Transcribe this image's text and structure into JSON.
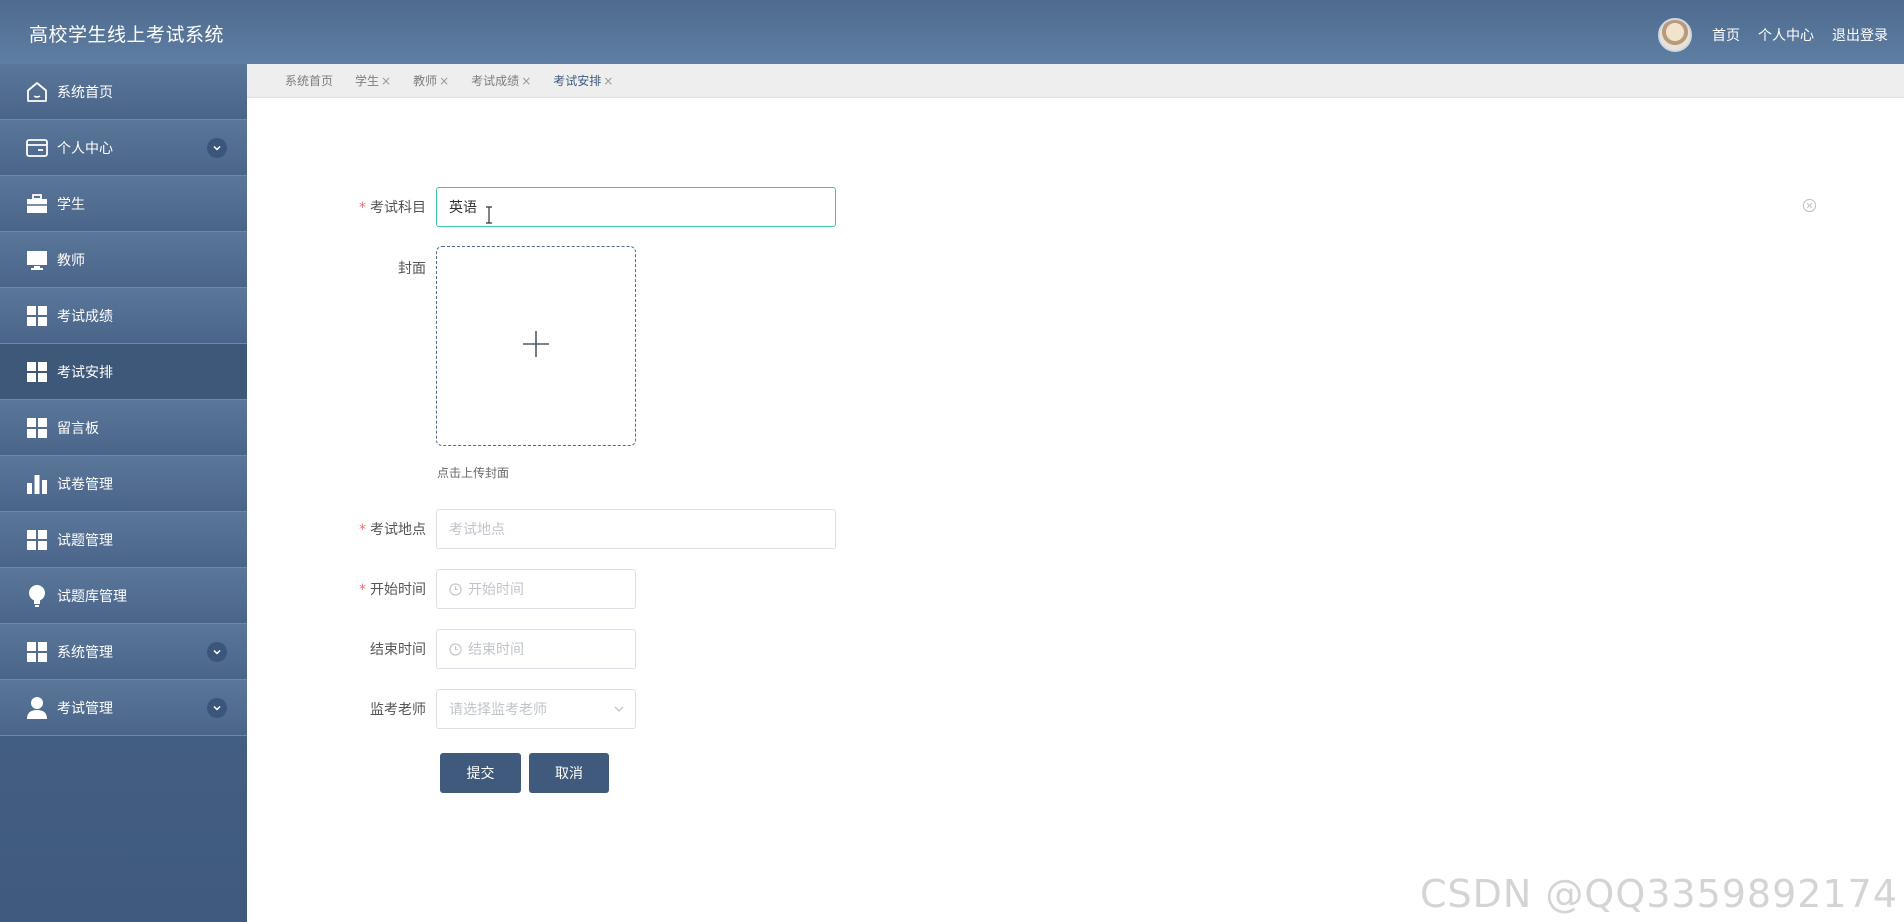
{
  "header": {
    "title": "高校学生线上考试系统",
    "links": [
      "首页",
      "个人中心",
      "退出登录"
    ]
  },
  "sidebar": {
    "items": [
      {
        "label": "系统首页",
        "icon": "home-icon",
        "active": false,
        "expandable": false
      },
      {
        "label": "个人中心",
        "icon": "id-card-icon",
        "active": false,
        "expandable": true
      },
      {
        "label": "学生",
        "icon": "briefcase-icon",
        "active": false,
        "expandable": false
      },
      {
        "label": "教师",
        "icon": "monitor-icon",
        "active": false,
        "expandable": false
      },
      {
        "label": "考试成绩",
        "icon": "grid-icon",
        "active": false,
        "expandable": false
      },
      {
        "label": "考试安排",
        "icon": "grid-icon",
        "active": true,
        "expandable": false
      },
      {
        "label": "留言板",
        "icon": "grid-icon",
        "active": false,
        "expandable": false
      },
      {
        "label": "试卷管理",
        "icon": "bar-chart-icon",
        "active": false,
        "expandable": false
      },
      {
        "label": "试题管理",
        "icon": "grid-icon",
        "active": false,
        "expandable": false
      },
      {
        "label": "试题库管理",
        "icon": "lightbulb-icon",
        "active": false,
        "expandable": false
      },
      {
        "label": "系统管理",
        "icon": "grid-icon",
        "active": false,
        "expandable": true
      },
      {
        "label": "考试管理",
        "icon": "user-icon",
        "active": false,
        "expandable": true
      }
    ]
  },
  "tabs": [
    {
      "label": "系统首页",
      "closable": false,
      "active": false
    },
    {
      "label": "学生",
      "closable": true,
      "active": false
    },
    {
      "label": "教师",
      "closable": true,
      "active": false
    },
    {
      "label": "考试成绩",
      "closable": true,
      "active": false
    },
    {
      "label": "考试安排",
      "closable": true,
      "active": true
    }
  ],
  "tab_close_glyph": "×",
  "form": {
    "subject": {
      "label": "考试科目",
      "value": "英语",
      "required": true
    },
    "cover": {
      "label": "封面",
      "tip": "点击上传封面"
    },
    "location": {
      "label": "考试地点",
      "placeholder": "考试地点",
      "required": true
    },
    "start_time": {
      "label": "开始时间",
      "placeholder": "开始时间",
      "required": true
    },
    "end_time": {
      "label": "结束时间",
      "placeholder": "结束时间",
      "required": false
    },
    "proctor": {
      "label": "监考老师",
      "placeholder": "请选择监考老师",
      "required": false
    },
    "submit_label": "提交",
    "cancel_label": "取消"
  },
  "watermark": "CSDN @QQ3359892174",
  "colors": {
    "header_bg": "#5a7699",
    "sidebar_active": "#3e5879",
    "button_bg": "#3f5a7d",
    "focus_border": "#3ec6a8",
    "required_star": "#f56c6c"
  }
}
